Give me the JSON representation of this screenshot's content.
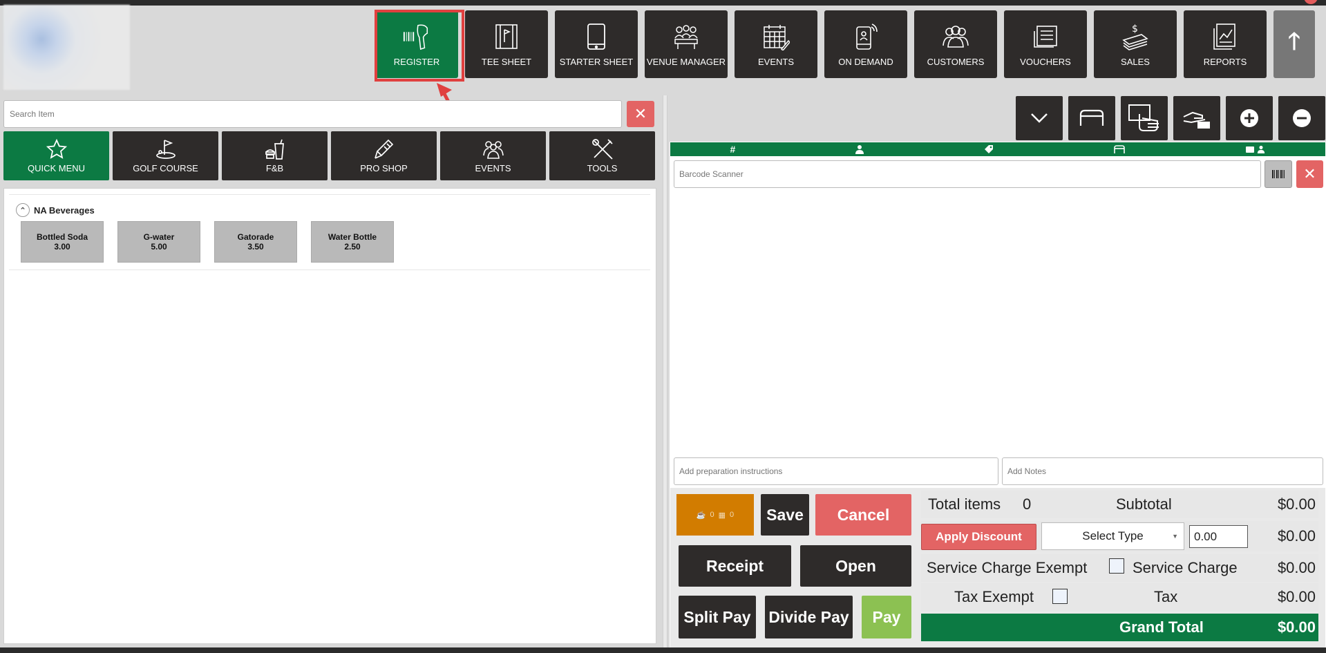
{
  "nav": {
    "items": [
      {
        "label": "REGISTER",
        "icon": "barcode-scanner-icon",
        "active": true
      },
      {
        "label": "TEE SHEET",
        "icon": "tee-sheet-icon"
      },
      {
        "label": "STARTER SHEET",
        "icon": "tablet-icon"
      },
      {
        "label": "VENUE MANAGER",
        "icon": "venue-manager-icon"
      },
      {
        "label": "EVENTS",
        "icon": "calendar-icon"
      },
      {
        "label": "ON DEMAND",
        "icon": "mobile-phone-icon"
      },
      {
        "label": "CUSTOMERS",
        "icon": "customers-icon"
      },
      {
        "label": "VOUCHERS",
        "icon": "voucher-icon"
      },
      {
        "label": "SALES",
        "icon": "sales-icon"
      },
      {
        "label": "REPORTS",
        "icon": "reports-icon"
      }
    ],
    "up_icon": "arrow-up-icon"
  },
  "search": {
    "placeholder": "Search Item"
  },
  "categories": [
    {
      "label": "QUICK MENU",
      "icon": "star-icon",
      "active": true
    },
    {
      "label": "GOLF COURSE",
      "icon": "golf-icon"
    },
    {
      "label": "F&B",
      "icon": "drink-icon"
    },
    {
      "label": "PRO SHOP",
      "icon": "golf-club-icon"
    },
    {
      "label": "EVENTS",
      "icon": "people-icon"
    },
    {
      "label": "TOOLS",
      "icon": "tools-icon"
    }
  ],
  "menu": {
    "group_title": "NA Beverages",
    "items": [
      {
        "name": "Bottled Soda",
        "price": "3.00"
      },
      {
        "name": "G-water",
        "price": "5.00"
      },
      {
        "name": "Gatorade",
        "price": "3.50"
      },
      {
        "name": "Water Bottle",
        "price": "2.50"
      }
    ]
  },
  "order": {
    "barcode_placeholder": "Barcode Scanner",
    "prep_placeholder": "Add preparation instructions",
    "notes_placeholder": "Add Notes",
    "counter_a": "0",
    "counter_b": "0"
  },
  "actions": {
    "save": "Save",
    "cancel": "Cancel",
    "receipt": "Receipt",
    "open": "Open",
    "split_pay": "Split Pay",
    "divide_pay": "Divide Pay",
    "pay": "Pay"
  },
  "totals": {
    "total_items_label": "Total items",
    "total_items_value": "0",
    "subtotal_label": "Subtotal",
    "subtotal_value": "$0.00",
    "apply_discount": "Apply Discount",
    "select_type": "Select Type",
    "discount_input": "0.00",
    "discount_value": "$0.00",
    "service_exempt_label": "Service Charge Exempt",
    "service_charge_label": "Service Charge",
    "service_charge_value": "$0.00",
    "tax_exempt_label": "Tax Exempt",
    "tax_label": "Tax",
    "tax_value": "$0.00",
    "grand_total_label": "Grand Total",
    "grand_total_value": "$0.00"
  },
  "colors": {
    "accent_green": "#0c7a43",
    "dark_button": "#2e2b2a",
    "danger_red": "#e36464",
    "pay_green": "#8cc152",
    "orange": "#d27c00"
  }
}
